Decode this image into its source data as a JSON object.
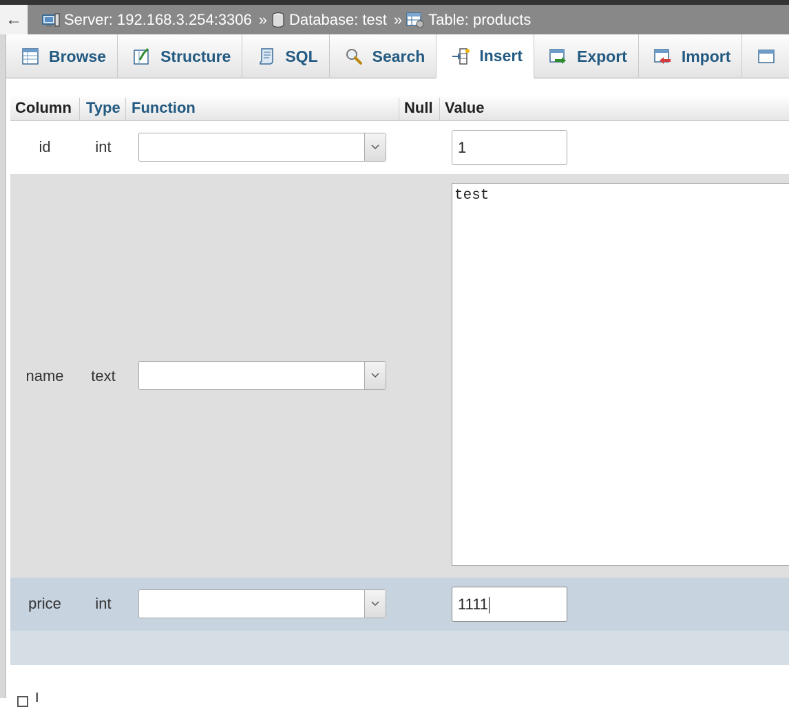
{
  "breadcrumb": {
    "back": "←",
    "server": "Server: 192.168.3.254:3306",
    "database": "Database: test",
    "table": "Table: products",
    "separator": "»"
  },
  "tabs": [
    {
      "label": "Browse",
      "icon": "browse-icon"
    },
    {
      "label": "Structure",
      "icon": "structure-icon"
    },
    {
      "label": "SQL",
      "icon": "sql-icon"
    },
    {
      "label": "Search",
      "icon": "search-icon"
    },
    {
      "label": "Insert",
      "icon": "insert-icon",
      "active": true
    },
    {
      "label": "Export",
      "icon": "export-icon"
    },
    {
      "label": "Import",
      "icon": "import-icon"
    }
  ],
  "table": {
    "headers": {
      "column": "Column",
      "type": "Type",
      "function": "Function",
      "null": "Null",
      "value": "Value"
    },
    "rows": [
      {
        "column": "id",
        "type": "int",
        "function": "",
        "value": "1"
      },
      {
        "column": "name",
        "type": "text",
        "function": "",
        "value": "test"
      },
      {
        "column": "price",
        "type": "int",
        "function": "",
        "value": "1111"
      }
    ]
  },
  "footer": {
    "ignore_label": "I"
  }
}
